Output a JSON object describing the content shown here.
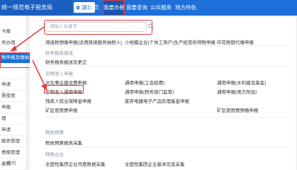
{
  "header": {
    "site_title": "统一规范电子税务局",
    "region": "湖北",
    "nav": [
      "首页",
      "我要办税",
      "我要查询",
      "公众服务",
      "地方特色"
    ]
  },
  "sidebar": {
    "items": [
      "卡报",
      "务办理",
      "税申报及缴纳",
      "",
      "申请",
      "票使用",
      "申报",
      "理",
      "申请",
      "服务管理",
      "情报管理",
      "退税"
    ],
    "bottom_label": "报机"
  },
  "main": {
    "search_placeholder": "请输入关键字",
    "rows_top": [
      "增值税预缴申报(适用跨境服务纳税人)",
      "小规模企业(个体工商户)生产经营所得税申报",
      "印花税额代缴申报"
    ],
    "section_fee": "财务报表报送",
    "row_fee": "财务报表报送及更正",
    "section_nontax": "非税收入申报",
    "nontax_rows": [
      [
        "文化事业建设费申报",
        "通用申报(工会经费)",
        "通用申报(水利建设基金)"
      ],
      [
        "非税收入通用申报",
        "通用申报(税务部门监管)",
        "通用申报(地方附加)"
      ],
      [
        "残疾人就业保障金申报",
        "废弃电器电子产品处理基金申报",
        ""
      ],
      [
        "矿区使用费申报",
        "",
        "矿区使用费预缴申报"
      ]
    ],
    "section_tax_collection": "税收预算",
    "row_tax_collection": "税收预算报表采集",
    "section_special": "特殊企业",
    "special_rows": [
      "全国性集团企业月度数据采集",
      "全国性集团企业基本信息采集"
    ]
  }
}
